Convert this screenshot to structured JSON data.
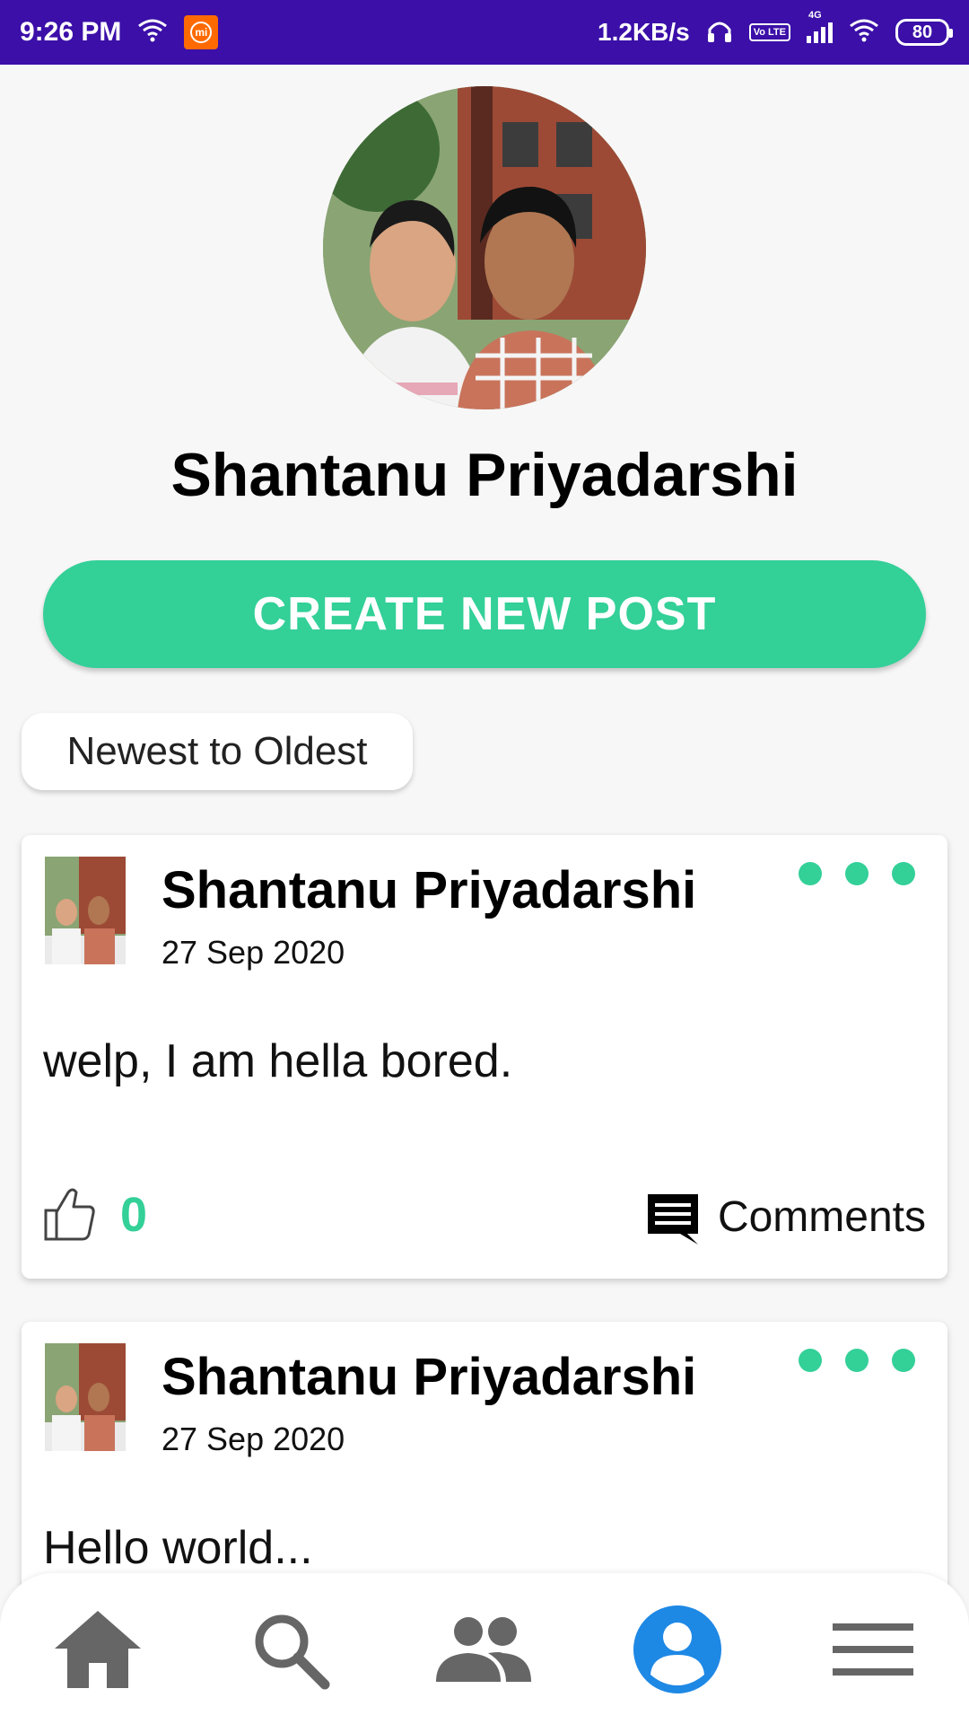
{
  "status_bar": {
    "time": "9:26 PM",
    "network_speed": "1.2KB/s",
    "volte": "Vo LTE",
    "signal_label": "4G",
    "battery": "80",
    "icons": [
      "wifi-icon",
      "mi-app-icon",
      "headset-icon",
      "volte-icon",
      "signal-icon",
      "wifi-icon",
      "battery-icon"
    ]
  },
  "profile": {
    "name": "Shantanu Priyadarshi",
    "avatar_icon": "profile-photo"
  },
  "actions": {
    "create_post_label": "CREATE NEW POST"
  },
  "sort": {
    "label": "Newest to Oldest"
  },
  "posts": [
    {
      "author": "Shantanu Priyadarshi",
      "date": "27 Sep 2020",
      "body": "welp, I am hella bored.",
      "likes": "0",
      "comments_label": "Comments"
    },
    {
      "author": "Shantanu Priyadarshi",
      "date": "27 Sep 2020",
      "body": "Hello world..."
    }
  ],
  "nav": {
    "items": [
      {
        "icon": "home-icon"
      },
      {
        "icon": "search-icon"
      },
      {
        "icon": "friends-icon"
      },
      {
        "icon": "profile-icon",
        "active": true
      },
      {
        "icon": "menu-icon"
      }
    ],
    "active_color": "#1e88e5",
    "inactive_color": "#666666"
  },
  "colors": {
    "status_bar": "#3b0fa8",
    "accent": "#33d098",
    "background": "#f7f7f7"
  }
}
